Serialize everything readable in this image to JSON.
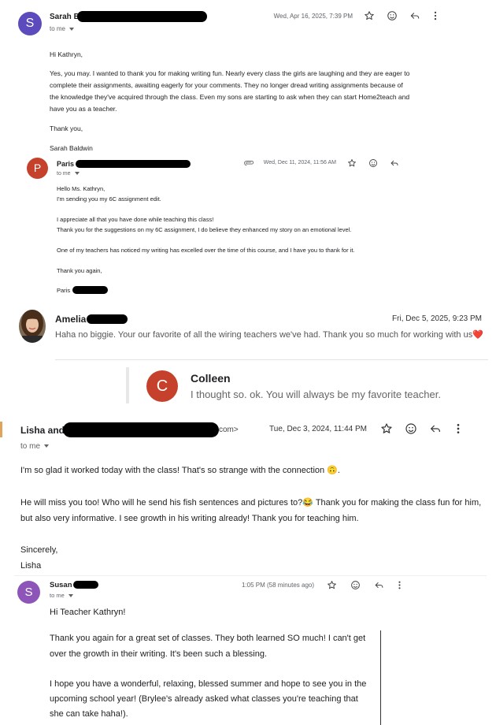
{
  "email1": {
    "avatar_letter": "S",
    "avatar_color": "#5c4bbd",
    "sender": "Sarah B",
    "date": "Wed, Apr 16, 2025, 7:39 PM",
    "to_me": "to me",
    "body": {
      "greeting": "Hi Kathryn,",
      "p1_l1": "Yes, you may. I wanted to thank you for making writing fun. Nearly every class the girls are laughing and they are eager to",
      "p1_l2": "complete their assignments, awaiting eagerly for your comments. They no longer dread writing assignments because of",
      "p1_l3": "the knowledge they've acquired through the class. Even my sons are starting to ask when they can start Home2teach and",
      "p1_l4": "have you as a teacher.",
      "thanks": "Thank you,",
      "signature": "Sarah Baldwin"
    }
  },
  "email2": {
    "avatar_letter": "P",
    "avatar_color": "#c5412c",
    "sender": "Paris",
    "date": "Wed, Dec 11, 2024, 11:56 AM",
    "to_me": "to me",
    "body": {
      "l1": "Hello Ms. Kathryn,",
      "l2": "I'm sending you my 6C assignment edit.",
      "l3": "I appreciate all that you have done while teaching this class!",
      "l4": "Thank you for the suggestions on my 6C assignment, I do believe they enhanced my story on an emotional level.",
      "l5": "One of my teachers has noticed my writing has excelled over the time of this course, and I have you to thank for it.",
      "l6": "Thank you again,",
      "l7": "Paris"
    }
  },
  "email3": {
    "sender": "Amelia",
    "date": "Fri, Dec 5, 2025, 9:23 PM",
    "message": "Haha no biggie. Your our favorite of all the wiring teachers we've had. Thank you so much for working with us",
    "emoji": "❤️"
  },
  "email4": {
    "avatar_letter": "C",
    "avatar_color": "#c5412c",
    "sender": "Colleen",
    "message": "I thought so. ok. You will always be my favorite teacher."
  },
  "email5": {
    "sender": "Lisha and",
    "address_suffix": "com>",
    "date": "Tue, Dec 3, 2024, 11:44 PM",
    "to_me": "to me",
    "body": {
      "l1": "I'm so glad it worked today with the class! That's so strange with the connection",
      "l1_emoji": "🙃",
      "l1_end": ".",
      "l2a": "He will miss you too! Who will he send his fish sentences and pictures to?",
      "l2_emoji": "😂",
      "l2b": " Thank you for making the class fun for him,",
      "l3": "but also very informative. I see growth in his writing already! Thank you for teaching him.",
      "l4": "Sincerely,",
      "l5": "Lisha"
    }
  },
  "email6": {
    "avatar_letter": "S",
    "avatar_color": "#8e55b8",
    "sender": "Susan",
    "date": "1:05 PM (58 minutes ago)",
    "to_me": "to me",
    "body": {
      "l1": "Hi Teacher Kathryn!",
      "l2": "Thank you again for a great set of classes. They both learned SO much! I can't get",
      "l3": "over the growth in their writing. It's been such a blessing.",
      "l4": "I hope you have a wonderful, relaxing, blessed summer and hope to see you in the",
      "l5": "upcoming school year! (Brylee's already asked what classes you're teaching that",
      "l6": "she can take haha!)."
    }
  },
  "icons": [
    "star-icon",
    "emoji-icon",
    "reply-icon",
    "more-icon",
    "attachment-icon"
  ]
}
